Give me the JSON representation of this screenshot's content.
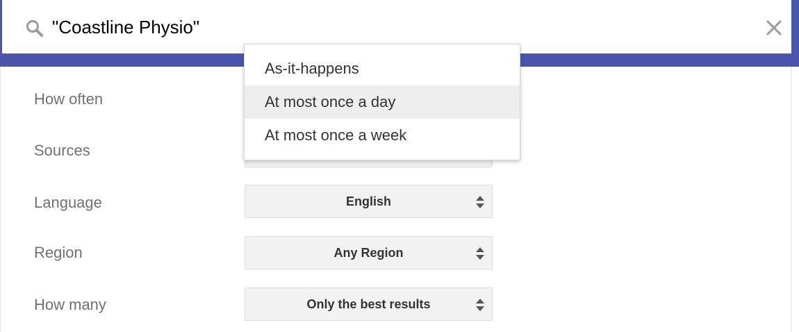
{
  "search": {
    "query": "\"Coastline Physio\"",
    "search_icon": "search-icon",
    "clear_icon": "close-icon"
  },
  "colors": {
    "header_band": "#4a56ad",
    "select_background": "#f2f2f2",
    "highlight": "#eeeeee"
  },
  "options": {
    "how_often": {
      "label": "How often",
      "open": true,
      "highlighted": "At most once a day",
      "menu": [
        "As-it-happens",
        "At most once a day",
        "At most once a week"
      ]
    },
    "sources": {
      "label": "Sources"
    },
    "language": {
      "label": "Language",
      "value": "English"
    },
    "region": {
      "label": "Region",
      "value": "Any Region"
    },
    "how_many": {
      "label": "How many",
      "value": "Only the best results"
    }
  }
}
